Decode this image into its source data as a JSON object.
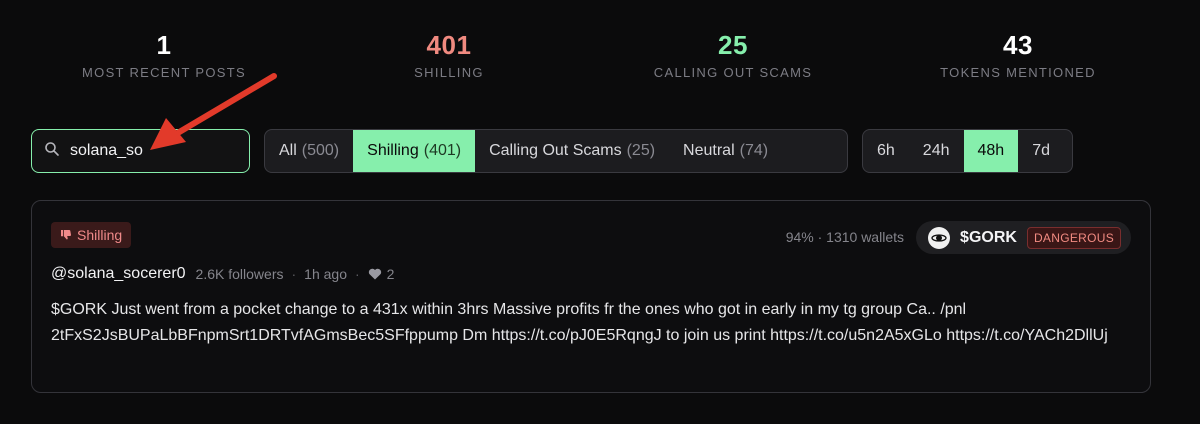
{
  "stats": [
    {
      "value": "1",
      "label": "MOST RECENT POSTS",
      "color": "#ffffff"
    },
    {
      "value": "401",
      "label": "SHILLING",
      "color": "#f08a80"
    },
    {
      "value": "25",
      "label": "CALLING OUT SCAMS",
      "color": "#86efac"
    },
    {
      "value": "43",
      "label": "TOKENS MENTIONED",
      "color": "#ffffff"
    }
  ],
  "search": {
    "value": "solana_so",
    "placeholder": "",
    "icon": "search-icon"
  },
  "filters": [
    {
      "label": "All",
      "count": "(500)",
      "active": false
    },
    {
      "label": "Shilling",
      "count": "(401)",
      "active": true
    },
    {
      "label": "Calling Out Scams",
      "count": "(25)",
      "active": false
    },
    {
      "label": "Neutral",
      "count": "(74)",
      "active": false
    }
  ],
  "timeframes": [
    {
      "label": "6h",
      "active": false
    },
    {
      "label": "24h",
      "active": false
    },
    {
      "label": "48h",
      "active": true
    },
    {
      "label": "7d",
      "active": false
    }
  ],
  "post": {
    "badge": "Shilling",
    "badge_icon": "thumbs-down-icon",
    "wallets": "94% · 1310 wallets",
    "token": {
      "symbol": "$GORK",
      "risk": "DANGEROUS",
      "icon": "token-logo-icon"
    },
    "handle": "@solana_socerer0",
    "followers": "2.6K followers",
    "time": "1h ago",
    "likes": "2",
    "like_icon": "heart-icon",
    "text": "$GORK Just went from a pocket change to a 431x within 3hrs Massive profits fr the ones who got in early in my tg group Ca.. /pnl 2tFxS2JsBUPaLbBFnpmSrt1DRTvfAGmsBec5SFfppump Dm https://t.co/pJ0E5RqngJ to join us print https://t.co/u5n2A5xGLo https://t.co/YACh2DllUj"
  },
  "colors": {
    "accent": "#86efac",
    "danger": "#f08a80",
    "annotation": "#e23a2a"
  }
}
